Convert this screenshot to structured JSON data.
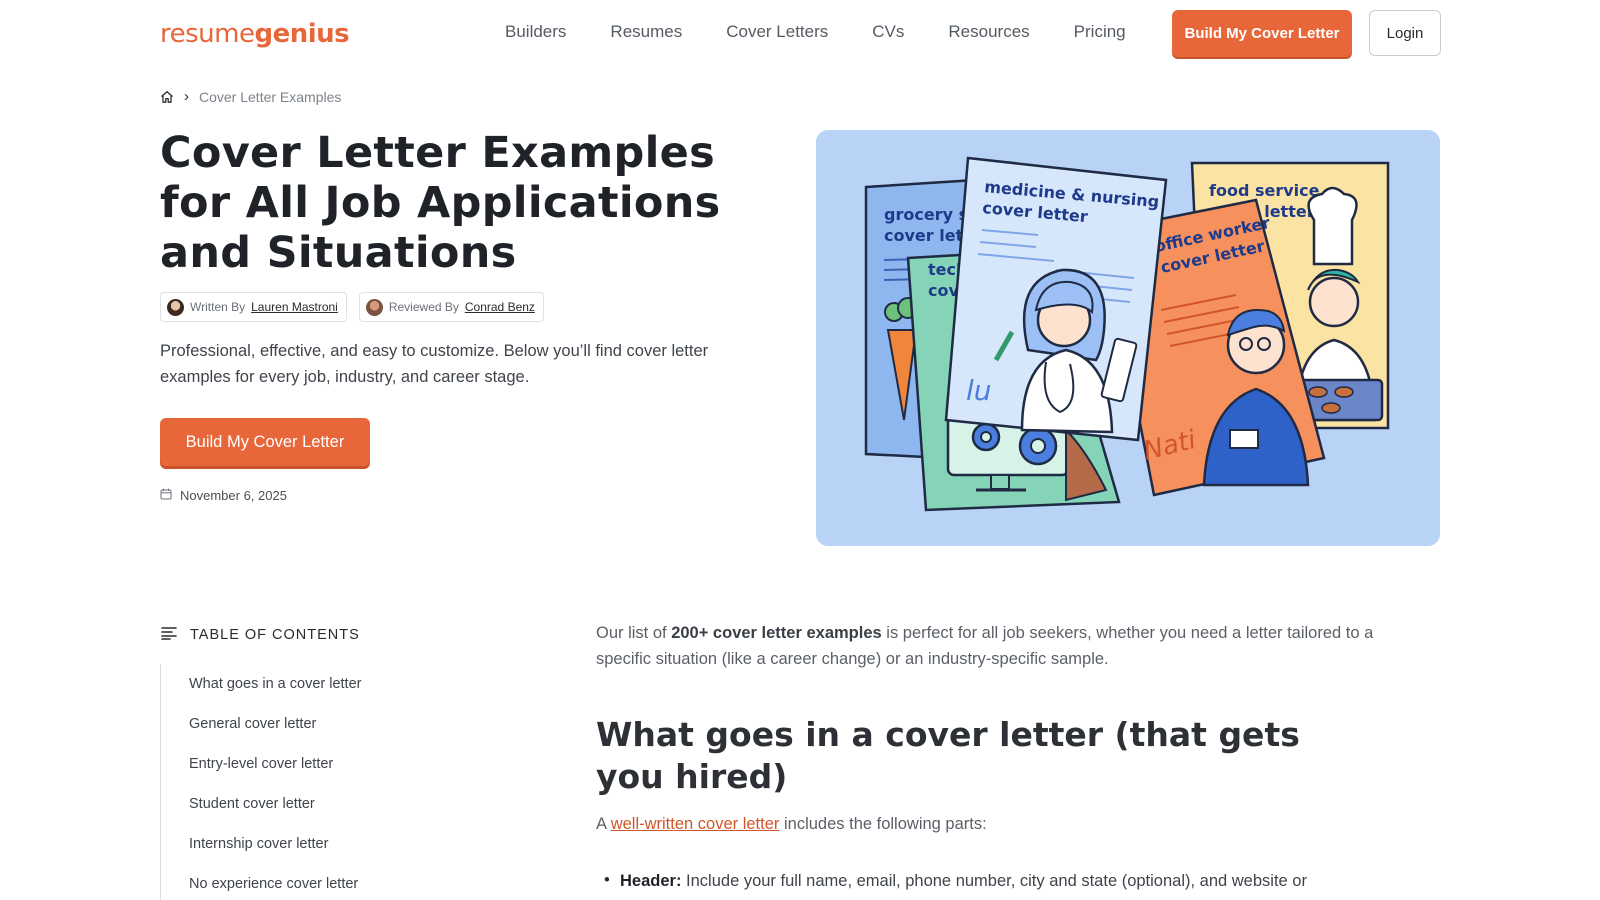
{
  "brand": {
    "logo_light": "resume",
    "logo_bold": "genius",
    "accent_color": "#e8673a"
  },
  "nav": {
    "items": [
      "Builders",
      "Resumes",
      "Cover Letters",
      "CVs",
      "Resources",
      "Pricing"
    ],
    "cta_label": "Build My Cover Letter",
    "login_label": "Login"
  },
  "breadcrumb": {
    "home_icon": "home-icon",
    "separator": "›",
    "current": "Cover Letter Examples"
  },
  "hero": {
    "title": "Cover Letter Examples for All Job Applications and Situations",
    "written_by_label": "Written By",
    "written_by_name": "Lauren Mastroni",
    "reviewed_by_label": "Reviewed By",
    "reviewed_by_name": "Conrad Benz",
    "description": "Professional, effective, and easy to customize. Below you’ll find cover letter examples for every job, industry, and career stage.",
    "cta_label": "Build My Cover Letter",
    "date": "November 6, 2025",
    "illustration": {
      "card_grocery": [
        "grocery s",
        "cover lett"
      ],
      "card_tech": [
        "tech",
        "cov"
      ],
      "card_medicine": [
        "medicine & nursing",
        "cover letter"
      ],
      "card_office": [
        "office worker",
        "cover letter"
      ],
      "card_food": [
        "food service",
        "cover letter"
      ],
      "signature_medicine": "lu",
      "signature_office": "Nati"
    }
  },
  "toc": {
    "heading": "TABLE OF CONTENTS",
    "items": [
      "What goes in a cover letter",
      "General cover letter",
      "Entry-level cover letter",
      "Student cover letter",
      "Internship cover letter",
      "No experience cover letter"
    ]
  },
  "article": {
    "intro_pre": "Our list of ",
    "intro_bold": "200+ cover letter examples",
    "intro_post": " is perfect for all job seekers, whether you need a letter tailored to a specific situation (like a career change) or an industry-specific sample.",
    "heading": "What goes in a cover letter (that gets you hired)",
    "para_pre": "A ",
    "para_link": "well-written cover letter",
    "para_post": " includes the following parts:",
    "bullet_bold": "Header:",
    "bullet_text": " Include your full name, email, phone number, city and state (optional), and website or"
  }
}
